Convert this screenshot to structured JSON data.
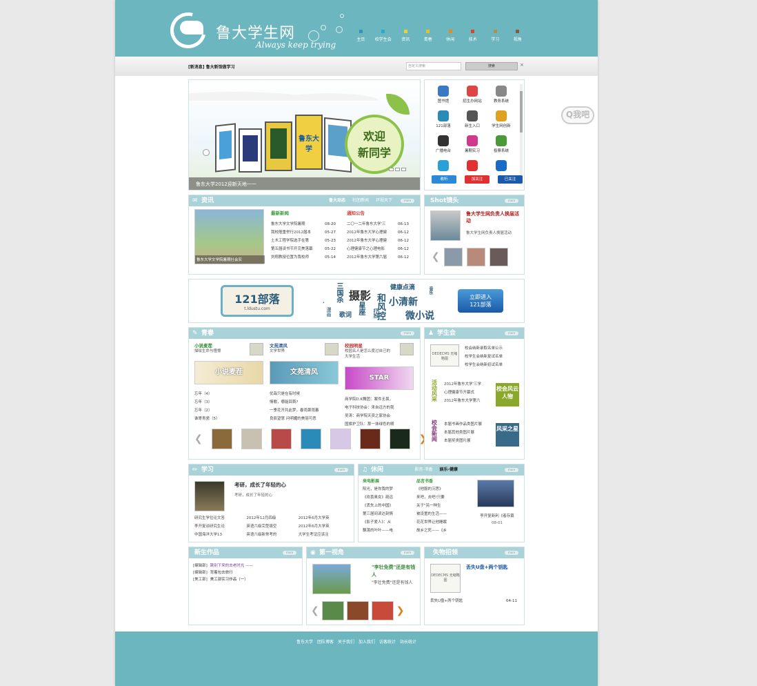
{
  "header": {
    "site_title": "鲁大学生网",
    "slogan": "Always keep trying",
    "nav": [
      {
        "label": "主页",
        "color": "#3a8fb7"
      },
      {
        "label": "校学生会",
        "color": "#32a6c9"
      },
      {
        "label": "资讯",
        "color": "#f0d030"
      },
      {
        "label": "青春",
        "color": "#e8c020"
      },
      {
        "label": "休闲",
        "color": "#e58a1c"
      },
      {
        "label": "技术",
        "color": "#d8462a"
      },
      {
        "label": "学习",
        "color": "#b38d4e"
      },
      {
        "label": "视角",
        "color": "#8a5a3a"
      }
    ]
  },
  "search": {
    "news_tip": "[新消息] 鲁大新馆做学习",
    "input_placeholder": "自定义搜索",
    "button": "搜索",
    "close": "×"
  },
  "banner": {
    "caption": "鲁东大学2012迎新天地一一",
    "welcome_line1": "欢迎",
    "welcome_line2": "新同学",
    "board_text": "鲁东大学"
  },
  "quicklinks": {
    "items": [
      {
        "label": "图书馆",
        "icon": "books-icon",
        "color": "#3a78c4"
      },
      {
        "label": "招生办网站",
        "icon": "house-icon",
        "color": "#d44"
      },
      {
        "label": "教务系统",
        "icon": "server-icon",
        "color": "#888"
      },
      {
        "label": "121部落",
        "icon": "logo-e-icon",
        "color": "#2a8ab8"
      },
      {
        "label": "新生入口",
        "icon": "person-icon",
        "color": "#555"
      },
      {
        "label": "学生网创新",
        "icon": "star-house-icon",
        "color": "#e0a020"
      },
      {
        "label": "广播电台",
        "icon": "radio-icon",
        "color": "#333"
      },
      {
        "label": "暑期实习",
        "icon": "dancer-icon",
        "color": "#d03a8a"
      },
      {
        "label": "投票系统",
        "icon": "people-icon",
        "color": "#4a9a3a"
      },
      {
        "label": "",
        "icon": "qq-icon",
        "color": "#2aa0d8"
      },
      {
        "label": "",
        "icon": "weibo-icon",
        "color": "#e03030"
      },
      {
        "label": "",
        "icon": "renren-icon",
        "color": "#1a6ac8"
      }
    ],
    "follow": [
      "收听",
      "加关注",
      "已关注"
    ]
  },
  "news": {
    "title": "资讯",
    "tabs": [
      "鲁大动态",
      "社团新闻",
      "环视天下"
    ],
    "more": "more",
    "photo_caption": "鲁东大学文学院暑期社会实",
    "latest_title": "最新新闻",
    "latest": [
      {
        "t": "鲁东大学文学院暑期",
        "d": "08-20"
      },
      {
        "t": "我校隆重举行2012届本",
        "d": "05-27"
      },
      {
        "t": "土木工程学院选手在第",
        "d": "05-23"
      },
      {
        "t": "第五届读书节开完美落幕",
        "d": "05-22"
      },
      {
        "t": "刘翔教授位置为我校师",
        "d": "05-14"
      }
    ],
    "notice_title": "通知公告",
    "notices": [
      {
        "t": "二〇一二年鲁东大学'三",
        "d": "06-13"
      },
      {
        "t": "2012年鲁东大学心理健",
        "d": "06-12"
      },
      {
        "t": "2012年鲁东大学心理健",
        "d": "06-12"
      },
      {
        "t": "心理健康节之心理电影",
        "d": "06-12"
      },
      {
        "t": "2012年鲁东大学第六届",
        "d": "06-12"
      }
    ]
  },
  "shot": {
    "title": "Shot镜头",
    "more": "more",
    "headline": "鲁大学生网负责人换届活动",
    "desc": "鲁大学生网负责人换届活动"
  },
  "ad": {
    "brand": "121部落",
    "url": "t.ldustu.com",
    "words": [
      "三国杀",
      "摄影",
      "和风控",
      "健康点滴",
      "小清新",
      "音乐",
      "星座",
      "歌词",
      "打扮",
      "微小说",
      "漫画",
      "·"
    ],
    "button_line1": "立即进入",
    "button_line2": "121部落"
  },
  "youth": {
    "title": "青春",
    "more": "more",
    "cols": [
      {
        "head": "小说麦茬",
        "sub": "描绘生命与憧憬",
        "banner": "小说麦茬",
        "items": [
          "忘年（4）",
          "忘年（3）",
          "忘年（2）",
          "谁寄青瓷（5）"
        ]
      },
      {
        "head": "文苑清风",
        "sub": "文学世界",
        "banner": "文苑清风",
        "items": [
          "优哉只是在有时候",
          "情歌，哪能回首?",
          "一季花开共此梦，春雨萧雨蕙",
          "良辰望慧 问明媚的美丽可恶"
        ]
      },
      {
        "head": "校园明星",
        "sub": "校园名人是怎么度过自己的大学生活",
        "banner": "STAR",
        "items": [
          "商学院D.K舞团：案件无畏，",
          "电子科技协会：来自远方的我",
          "吴涛：商学院天资之家协会·",
          "国旗护卫队：那一抹绿色的翱"
        ]
      }
    ]
  },
  "union": {
    "title": "学生会",
    "more": "more",
    "placeholder": "DEDECMS 无缩略图",
    "top_items": [
      "校会纳新录取名单公示",
      "校学生会纳新复试名单",
      "校学生会纳新初试名单"
    ],
    "activity_label": "活动风采",
    "activity_items": [
      "2012年鲁东大学'三学",
      "心理健康节开幕式",
      "2012年鲁东大学第六"
    ],
    "activity_btn": "校会风云人物",
    "school_label": "校会新闻",
    "school_items": [
      "本届书画作品类图片展",
      "本届其他类图片展",
      "本届奖类图片展"
    ],
    "school_btn": "风采之星"
  },
  "study": {
    "title": "学习",
    "more": "more",
    "headline": "考研，成长了年轻的心",
    "desc": "考研，成长了年轻的心",
    "rows": [
      [
        "研究生学位论文答",
        "2012年12月四级",
        "2012年6月大学英"
      ],
      [
        "李开复谈研究生论",
        "英语六级完型填空",
        "2012年6月大学英"
      ],
      [
        "中国海洋大学13",
        "英语六级新常考的",
        "大学生考证应该注"
      ]
    ]
  },
  "leisure": {
    "title": "休闲",
    "tabs": [
      "影音-书香",
      "娱乐-健康"
    ],
    "more": "more",
    "col1_title": "来电影展",
    "col1": [
      "阳光，是你我的梦",
      "《欢喜奥女》疏远",
      "《丢失上的中国》",
      "第三届间读达刻情",
      "《影子爱人》：从",
      "飘落的叶叶——电"
    ],
    "col2_title": "品言书香",
    "col2": [
      "《他服的沉思》",
      "来吧，去吧!只要",
      "关于\"另一种生",
      "被设置的生活——",
      "花花世界让他睡眠",
      "故乡之死——《乡"
    ],
    "photo_caption": "李开复新利《者存篇",
    "photo_date": "08-01"
  },
  "works": {
    "title": "新生作品",
    "more": "more",
    "items": [
      {
        "tag": "[编辑部]",
        "t": "跳别下来的去老时光 ——",
        "color": "#7a3a9a"
      },
      {
        "tag": "[编辑部]",
        "t": "背着包去旅行",
        "color": "#333"
      },
      {
        "tag": "[美工部]",
        "t": "美工部实习作品（一）",
        "color": "#333"
      }
    ]
  },
  "view": {
    "title": "第一视角",
    "more": "more",
    "headline": "\"李壮免费\"还是有钱人",
    "desc": "\"李壮免费\"还是有钱人"
  },
  "lost": {
    "title": "失物招领",
    "more": "more",
    "placeholder": "DEDECMS 无缩略图",
    "headline": "丢失U盘+两个钥匙",
    "item": "丢失U盘+两个钥匙",
    "date": "04-11"
  },
  "footer": {
    "links": [
      "鲁东大学",
      "团队博客",
      "关于我们",
      "加入我们",
      "访客统计",
      "站长统计"
    ]
  },
  "side": {
    "qq_text": "Q我吧"
  }
}
